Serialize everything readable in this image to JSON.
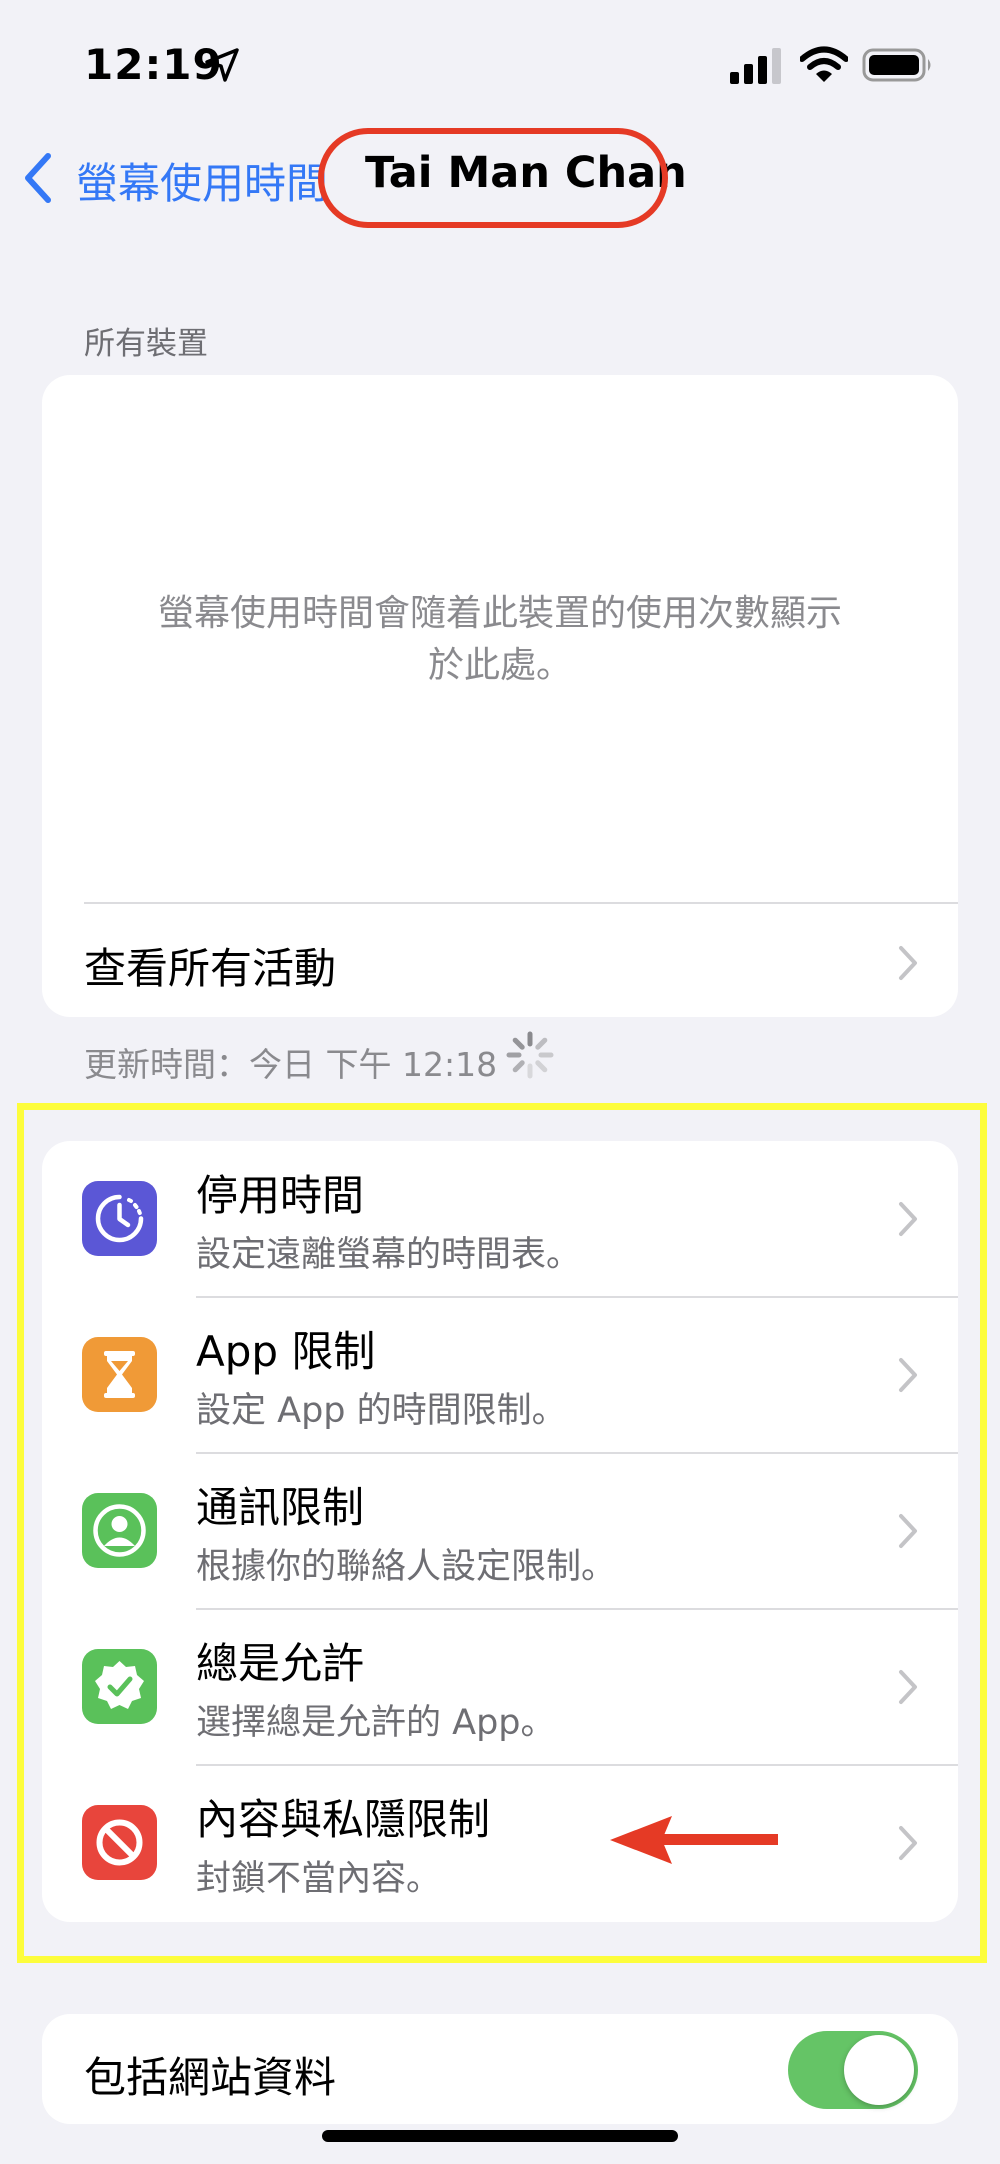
{
  "status_bar": {
    "time": "12:19"
  },
  "nav": {
    "back_label": "螢幕使用時間",
    "title": "Tai Man Chan"
  },
  "all_devices": {
    "section_header": "所有裝置",
    "empty_message_line1": "螢幕使用時間會隨着此裝置的使用次數顯示",
    "empty_message_line2": "於此處。",
    "see_all_label": "查看所有活動",
    "updated_text": "更新時間：今日 下午 12:18"
  },
  "limits": [
    {
      "title": "停用時間",
      "subtitle": "設定遠離螢幕的時間表。",
      "icon": "downtime-icon",
      "color": "#5b57d6"
    },
    {
      "title": "App 限制",
      "subtitle": "設定 App 的時間限制。",
      "icon": "hourglass-icon",
      "color": "#f09a37"
    },
    {
      "title": "通訊限制",
      "subtitle": "根據你的聯絡人設定限制。",
      "icon": "contact-icon",
      "color": "#5ac15a"
    },
    {
      "title": "總是允許",
      "subtitle": "選擇總是允許的 App。",
      "icon": "checkmark-badge-icon",
      "color": "#5ac15a"
    },
    {
      "title": "內容與私隱限制",
      "subtitle": "封鎖不當內容。",
      "icon": "block-icon",
      "color": "#e8453c"
    }
  ],
  "website_data": {
    "label": "包括網站資料",
    "enabled": true
  },
  "colors": {
    "accent": "#3478f6",
    "toggle_on": "#65c466",
    "annotation_red": "#e53a25",
    "annotation_yellow": "#fdfd3c"
  }
}
